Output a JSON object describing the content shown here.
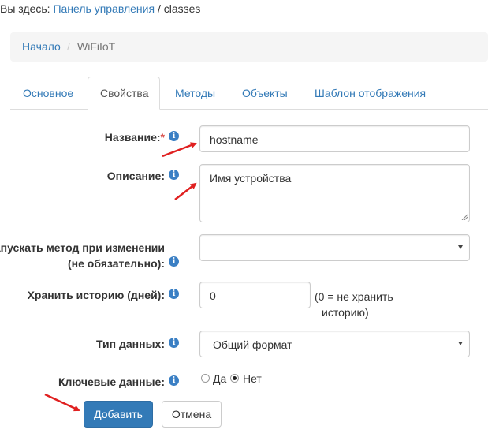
{
  "top_path": {
    "prefix": "Вы здесь:",
    "link": "Панель управления",
    "separator": "/",
    "current": "classes"
  },
  "breadcrumb": {
    "home": "Начало",
    "separator": "/",
    "current": "WiFiIoT"
  },
  "tabs": [
    {
      "label": "Основное",
      "active": false
    },
    {
      "label": "Свойства",
      "active": true
    },
    {
      "label": "Методы",
      "active": false
    },
    {
      "label": "Объекты",
      "active": false
    },
    {
      "label": "Шаблон отображения",
      "active": false
    }
  ],
  "form": {
    "name": {
      "label": "Название:",
      "required_mark": "*",
      "value": "hostname"
    },
    "description": {
      "label": "Описание:",
      "value": "Имя устройства"
    },
    "on_change_method": {
      "label_line1": "Запускать метод при изменении",
      "label_line2": "(не обязательно):",
      "value": ""
    },
    "keep_history": {
      "label": "Хранить историю (дней):",
      "value": "0",
      "hint_line1": "(0 = не хранить",
      "hint_line2": "историю)"
    },
    "data_type": {
      "label": "Тип данных:",
      "value": "Общий формат"
    },
    "key_data": {
      "label": "Ключевые данные:",
      "option_yes": "Да",
      "option_no": "Нет",
      "selected": "Нет"
    }
  },
  "buttons": {
    "add": "Добавить",
    "cancel": "Отмена"
  },
  "icons": {
    "info": "i"
  },
  "colors": {
    "link": "#337ab7",
    "primary": "#337ab7",
    "required": "#d9534f",
    "annotation_arrow": "#e02020"
  }
}
